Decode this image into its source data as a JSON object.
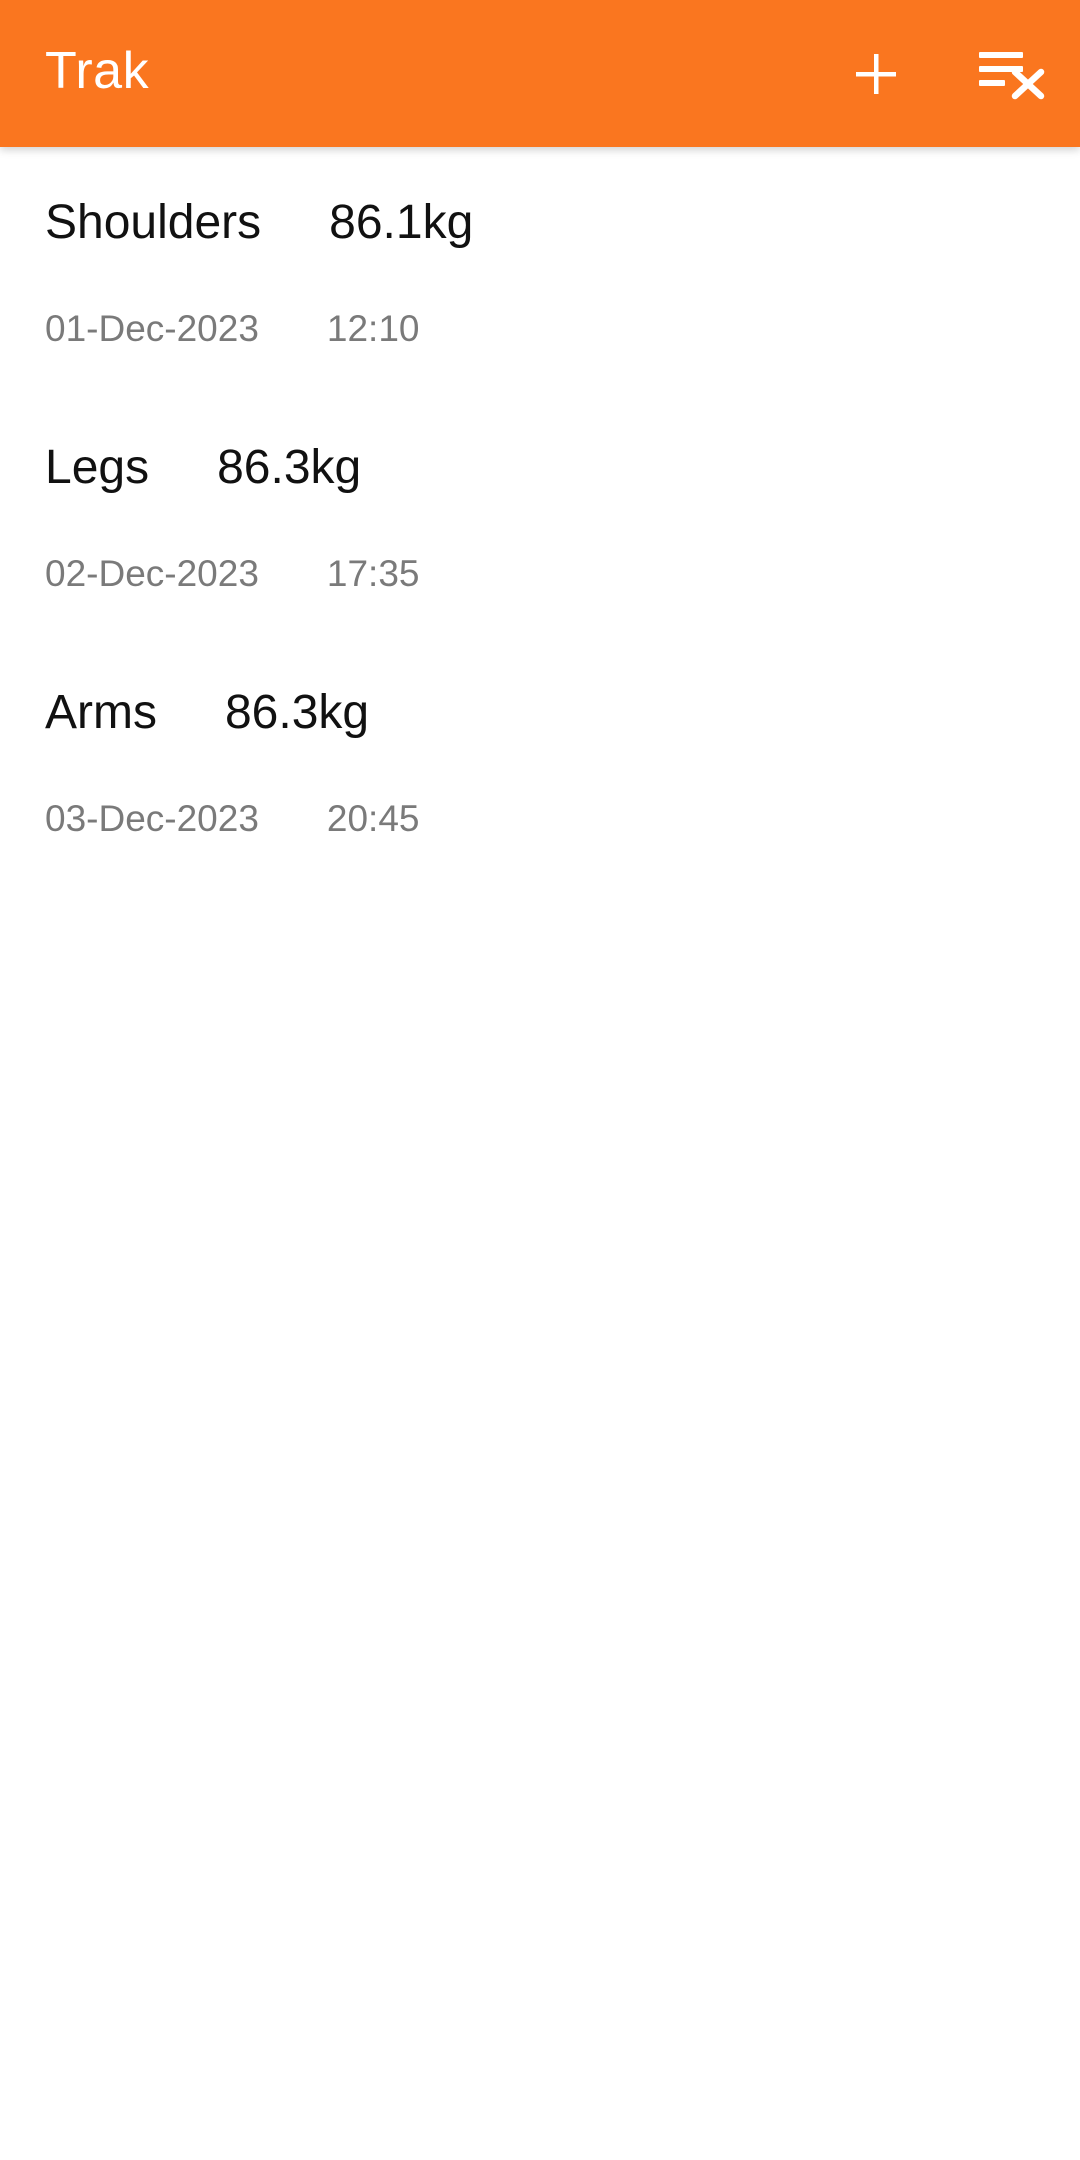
{
  "app_bar": {
    "title": "Trak",
    "background_color": "#FA761F",
    "actions": [
      {
        "name": "add",
        "icon": "plus-icon"
      },
      {
        "name": "clear-all",
        "icon": "clear-list-icon"
      }
    ]
  },
  "entries": [
    {
      "name": "Shoulders",
      "weight": "86.1kg",
      "date": "01-Dec-2023",
      "time": "12:10"
    },
    {
      "name": "Legs",
      "weight": "86.3kg",
      "date": "02-Dec-2023",
      "time": "17:35"
    },
    {
      "name": "Arms",
      "weight": "86.3kg",
      "date": "03-Dec-2023",
      "time": "20:45"
    }
  ]
}
